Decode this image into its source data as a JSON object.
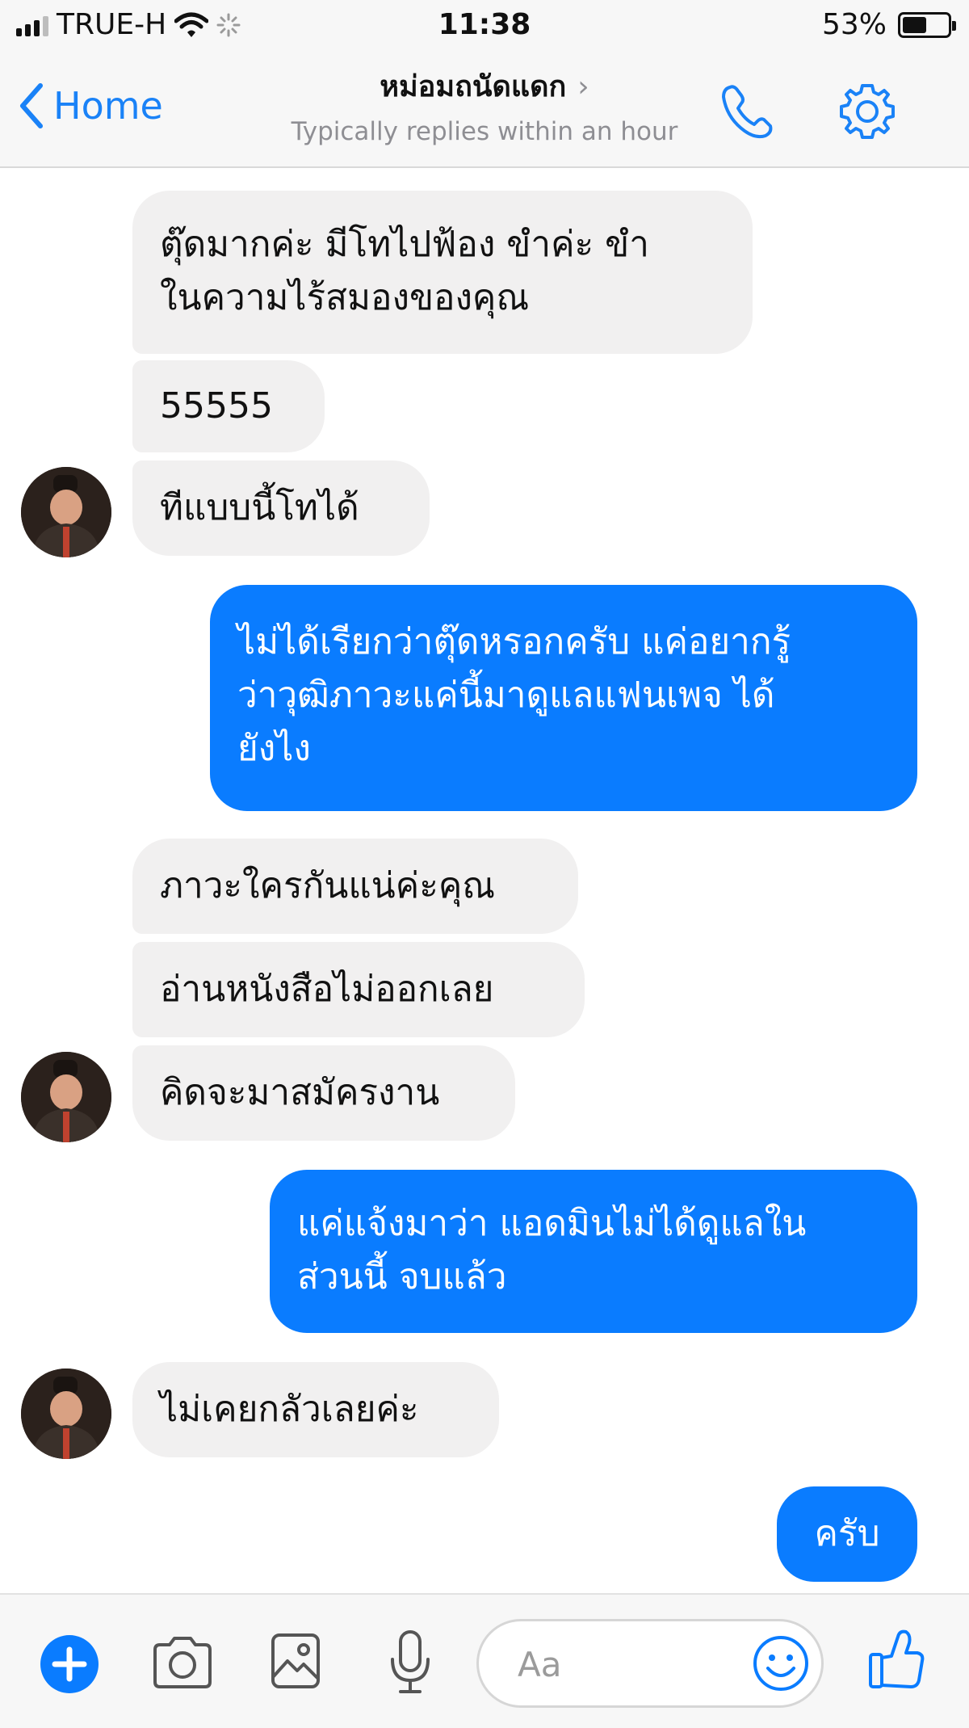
{
  "status_bar": {
    "carrier": "TRUE-H",
    "time": "11:38",
    "battery": "53%",
    "battery_level": 0.53
  },
  "header": {
    "back_label": "Home",
    "title": "หม่อมถนัดแดก",
    "subtitle": "Typically replies within an hour"
  },
  "messages": [
    {
      "from": "page",
      "lines": [
        "ตุ๊ดมากค่ะ มีโทไปฟ้อง ขำค่ะ ขำ",
        "ในความไร้สมองของคุณ"
      ]
    },
    {
      "from": "page",
      "lines": [
        "55555"
      ]
    },
    {
      "from": "page",
      "lines": [
        "ทีแบบนี้โทได้"
      ]
    },
    {
      "from": "me",
      "lines": [
        "ไม่ได้เรียกว่าตุ๊ดหรอกครับ แค่อยากรู้",
        "ว่าวุฒิภาวะแค่นี้มาดูแลแฟนเพจ ได้",
        "ยังไง"
      ]
    },
    {
      "from": "page",
      "lines": [
        "ภาวะใครกันแน่ค่ะคุณ"
      ]
    },
    {
      "from": "page",
      "lines": [
        "อ่านหนังสือไม่ออกเลย"
      ]
    },
    {
      "from": "page",
      "lines": [
        "คิดจะมาสมัครงาน"
      ]
    },
    {
      "from": "me",
      "lines": [
        "แค่แจ้งมาว่า แอดมินไม่ได้ดูแลใน",
        "ส่วนนี้ จบแล้ว"
      ]
    },
    {
      "from": "page",
      "lines": [
        "ไม่เคยกลัวเลยค่ะ"
      ]
    },
    {
      "from": "me",
      "lines": [
        "ครับ"
      ]
    }
  ],
  "composer": {
    "placeholder": "Aa"
  },
  "colors": {
    "accent": "#0a7cff",
    "incoming_bubble": "#f1f0f0",
    "link_blue": "#1a82f7"
  }
}
